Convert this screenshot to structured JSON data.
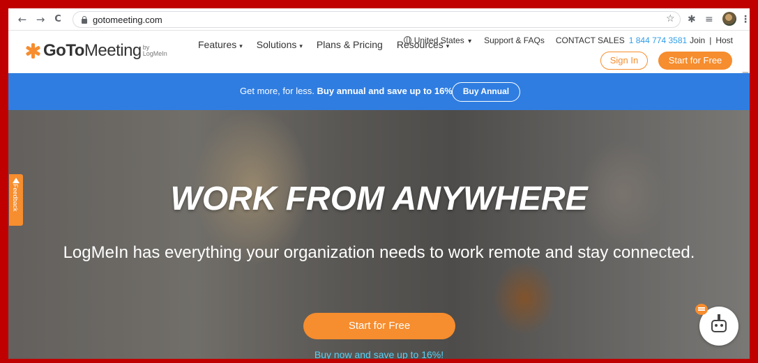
{
  "browser": {
    "url": "gotomeeting.com",
    "back_icon": "←",
    "forward_icon": "→",
    "reload_icon": "C",
    "star_icon": "☆",
    "extensions_icon": "✱",
    "media_icon": "≡",
    "menu_icon": "⋮"
  },
  "header": {
    "region": "United States",
    "region_caret": "▾",
    "support": "Support & FAQs",
    "contact_sales": "CONTACT SALES",
    "phone": "1 844 774 3581",
    "join": "Join",
    "separator": "|",
    "host": "Host",
    "logo_goto": "GoTo",
    "logo_meeting": "Meeting",
    "logo_by": "by",
    "logo_logmein": "LogMeIn",
    "nav": [
      {
        "label": "Features",
        "caret": "▾"
      },
      {
        "label": "Solutions",
        "caret": "▾"
      },
      {
        "label": "Plans & Pricing",
        "caret": ""
      },
      {
        "label": "Resources",
        "caret": "▾"
      }
    ],
    "sign_in": "Sign In",
    "start_free": "Start for Free"
  },
  "promo": {
    "text": "Get more, for less.",
    "bold": "Buy annual and save up to 16%",
    "button": "Buy Annual"
  },
  "hero": {
    "headline": "WORK FROM ANYWHERE",
    "subtitle": "LogMeIn has everything your organization needs to work remote and stay connected.",
    "cta": "Start for Free",
    "promo_link": "Buy now and save up to 16%!"
  },
  "feedback": {
    "label": "Feedback"
  },
  "colors": {
    "accent": "#f68d2e",
    "promo_bg": "#2f7de1",
    "frame": "#c00000"
  }
}
